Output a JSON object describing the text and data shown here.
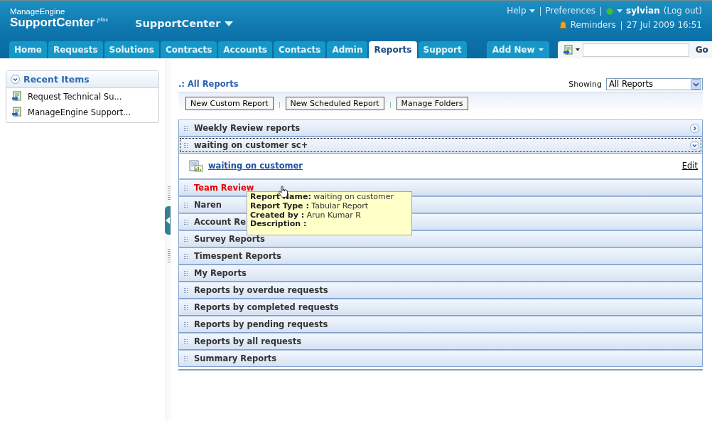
{
  "header": {
    "vendor": "ManageEngine",
    "product": "SupportCenter",
    "edition": "plus",
    "switcher": "SupportCenter",
    "links": [
      {
        "kind": "menu",
        "label": "Help"
      },
      {
        "kind": "link",
        "label": "Preferences"
      }
    ],
    "user": {
      "online": true,
      "name": "sylvian",
      "logout": "(Log out)"
    },
    "reminders": "Reminders",
    "datetime": "27 Jul 2009 16:51"
  },
  "tabs": [
    {
      "label": "Home",
      "selected": false
    },
    {
      "label": "Requests",
      "selected": false
    },
    {
      "label": "Solutions",
      "selected": false
    },
    {
      "label": "Contracts",
      "selected": false
    },
    {
      "label": "Accounts",
      "selected": false
    },
    {
      "label": "Contacts",
      "selected": false
    },
    {
      "label": "Admin",
      "selected": false
    },
    {
      "label": "Reports",
      "selected": true
    },
    {
      "label": "Support",
      "selected": false
    }
  ],
  "add_new": "Add New",
  "search": {
    "button": "Go"
  },
  "recent_items": {
    "title": "Recent Items",
    "items": [
      "Request Technical Su...",
      "ManageEngine Support..."
    ]
  },
  "reports": {
    "title": ".: All Reports",
    "showing_label": "Showing",
    "showing_value": "All Reports",
    "buttons": [
      "New Custom Report",
      "New Scheduled Report",
      "Manage Folders"
    ],
    "folders": [
      {
        "title": "Weekly Review reports",
        "expanded": false,
        "hovered": false
      },
      {
        "title": "waiting on customer sc+",
        "expanded": true,
        "hovered": false,
        "reports": [
          {
            "name": "waiting on customer",
            "action": "Edit"
          }
        ]
      },
      {
        "title": "Team Review",
        "expanded": false,
        "hovered": true
      },
      {
        "title": "Naren",
        "expanded": false,
        "hovered": false
      },
      {
        "title": "Account Re",
        "expanded": false,
        "hovered": false
      },
      {
        "title": "Survey Reports",
        "expanded": false,
        "hovered": false
      },
      {
        "title": "Timespent Reports",
        "expanded": false,
        "hovered": false
      },
      {
        "title": "My Reports",
        "expanded": false,
        "hovered": false
      },
      {
        "title": "Reports by overdue requests",
        "expanded": false,
        "hovered": false
      },
      {
        "title": "Reports by completed requests",
        "expanded": false,
        "hovered": false
      },
      {
        "title": "Reports by pending requests",
        "expanded": false,
        "hovered": false
      },
      {
        "title": "Reports by all requests",
        "expanded": false,
        "hovered": false
      },
      {
        "title": "Summary Reports",
        "expanded": false,
        "hovered": false
      }
    ]
  },
  "tooltip": {
    "lines": [
      {
        "label": "Report Name:",
        "value": "waiting on customer"
      },
      {
        "label": "Report Type :",
        "value": "Tabular Report"
      },
      {
        "label": "Created by :",
        "value": "Arun Kumar R"
      },
      {
        "label": "Description :"
      }
    ]
  }
}
